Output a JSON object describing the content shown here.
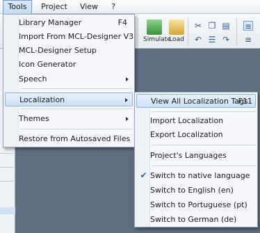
{
  "menubar": {
    "items": [
      {
        "label": "Tools"
      },
      {
        "label": "Project"
      },
      {
        "label": "View"
      },
      {
        "label": "?"
      }
    ]
  },
  "ribbon": {
    "simulate_label": "Simulate",
    "load_label": "Load"
  },
  "tools_menu": {
    "items": [
      {
        "label": "Library Manager",
        "shortcut": "F4"
      },
      {
        "label": "Import From MCL-Designer V3"
      },
      {
        "label": "MCL-Designer Setup"
      },
      {
        "label": "Icon Generator"
      },
      {
        "label": "Speech"
      },
      {
        "label": "Localization"
      },
      {
        "label": "Themes"
      },
      {
        "label": "Restore from Autosaved Files"
      }
    ]
  },
  "localization_menu": {
    "items": [
      {
        "label": "View All Localization Tags",
        "shortcut": "F11"
      },
      {
        "label": "Import Localization"
      },
      {
        "label": "Export Localization"
      },
      {
        "label": "Project's Languages"
      },
      {
        "label": "Switch to native language",
        "checked": true
      },
      {
        "label": "Switch to English  (en)"
      },
      {
        "label": "Switch to Portuguese  (pt)"
      },
      {
        "label": "Switch to German  (de)"
      }
    ]
  },
  "colors": {
    "highlight": "#cde0f5",
    "canvas": "#5e6e81"
  }
}
